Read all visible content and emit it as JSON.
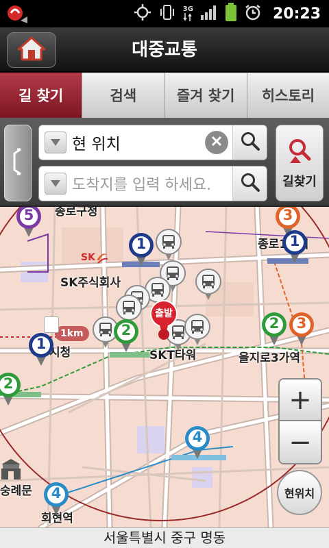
{
  "status_bar": {
    "time": "20:23",
    "net_label": "3G"
  },
  "header": {
    "title": "대중교통"
  },
  "tabs": [
    {
      "label": "길 찾기",
      "active": true
    },
    {
      "label": "검색",
      "active": false
    },
    {
      "label": "즐겨 찾기",
      "active": false
    },
    {
      "label": "히스토리",
      "active": false
    }
  ],
  "search": {
    "origin_value": "현 위치",
    "destination_placeholder": "도착지를 입력 하세요.",
    "route_button_label": "길찾기"
  },
  "map": {
    "labels": {
      "jongno_gu": "종로구청",
      "sk": "SK주식회사",
      "jongno1ga": "종로1가역",
      "cityhall": "시청",
      "skt_tower": "SKT타워",
      "euljiro3ga": "을지로3가역",
      "sungnyemun": "숭례문",
      "hoehyeon": "회현역",
      "sk_logo": "SK",
      "scale": "1km",
      "start_badge": "출발"
    },
    "subway_markers": [
      {
        "name": "marker-line5",
        "line": "5"
      },
      {
        "name": "marker-line3-top",
        "line": "3"
      },
      {
        "name": "marker-line1-top",
        "line": "1"
      },
      {
        "name": "marker-line1-top-right",
        "line": "1"
      },
      {
        "name": "marker-line1-cityhall",
        "line": "1"
      },
      {
        "name": "marker-line2-center",
        "line": "2"
      },
      {
        "name": "marker-line2-euljiro",
        "line": "2"
      },
      {
        "name": "marker-line3-euljiro",
        "line": "3"
      },
      {
        "name": "marker-line2-left",
        "line": "2"
      },
      {
        "name": "marker-line4-center",
        "line": "4"
      },
      {
        "name": "marker-line4-hoehyeon",
        "line": "4"
      }
    ],
    "zoom_in": "+",
    "zoom_out": "−",
    "my_location_label": "현위치",
    "line_colors": {
      "1": "#1e3a8a",
      "2": "#2f9a3a",
      "3": "#e0632a",
      "4": "#2a8cc7",
      "5": "#7b3aa6"
    }
  },
  "address_bar": {
    "text": "서울특별시 중구 명동"
  }
}
